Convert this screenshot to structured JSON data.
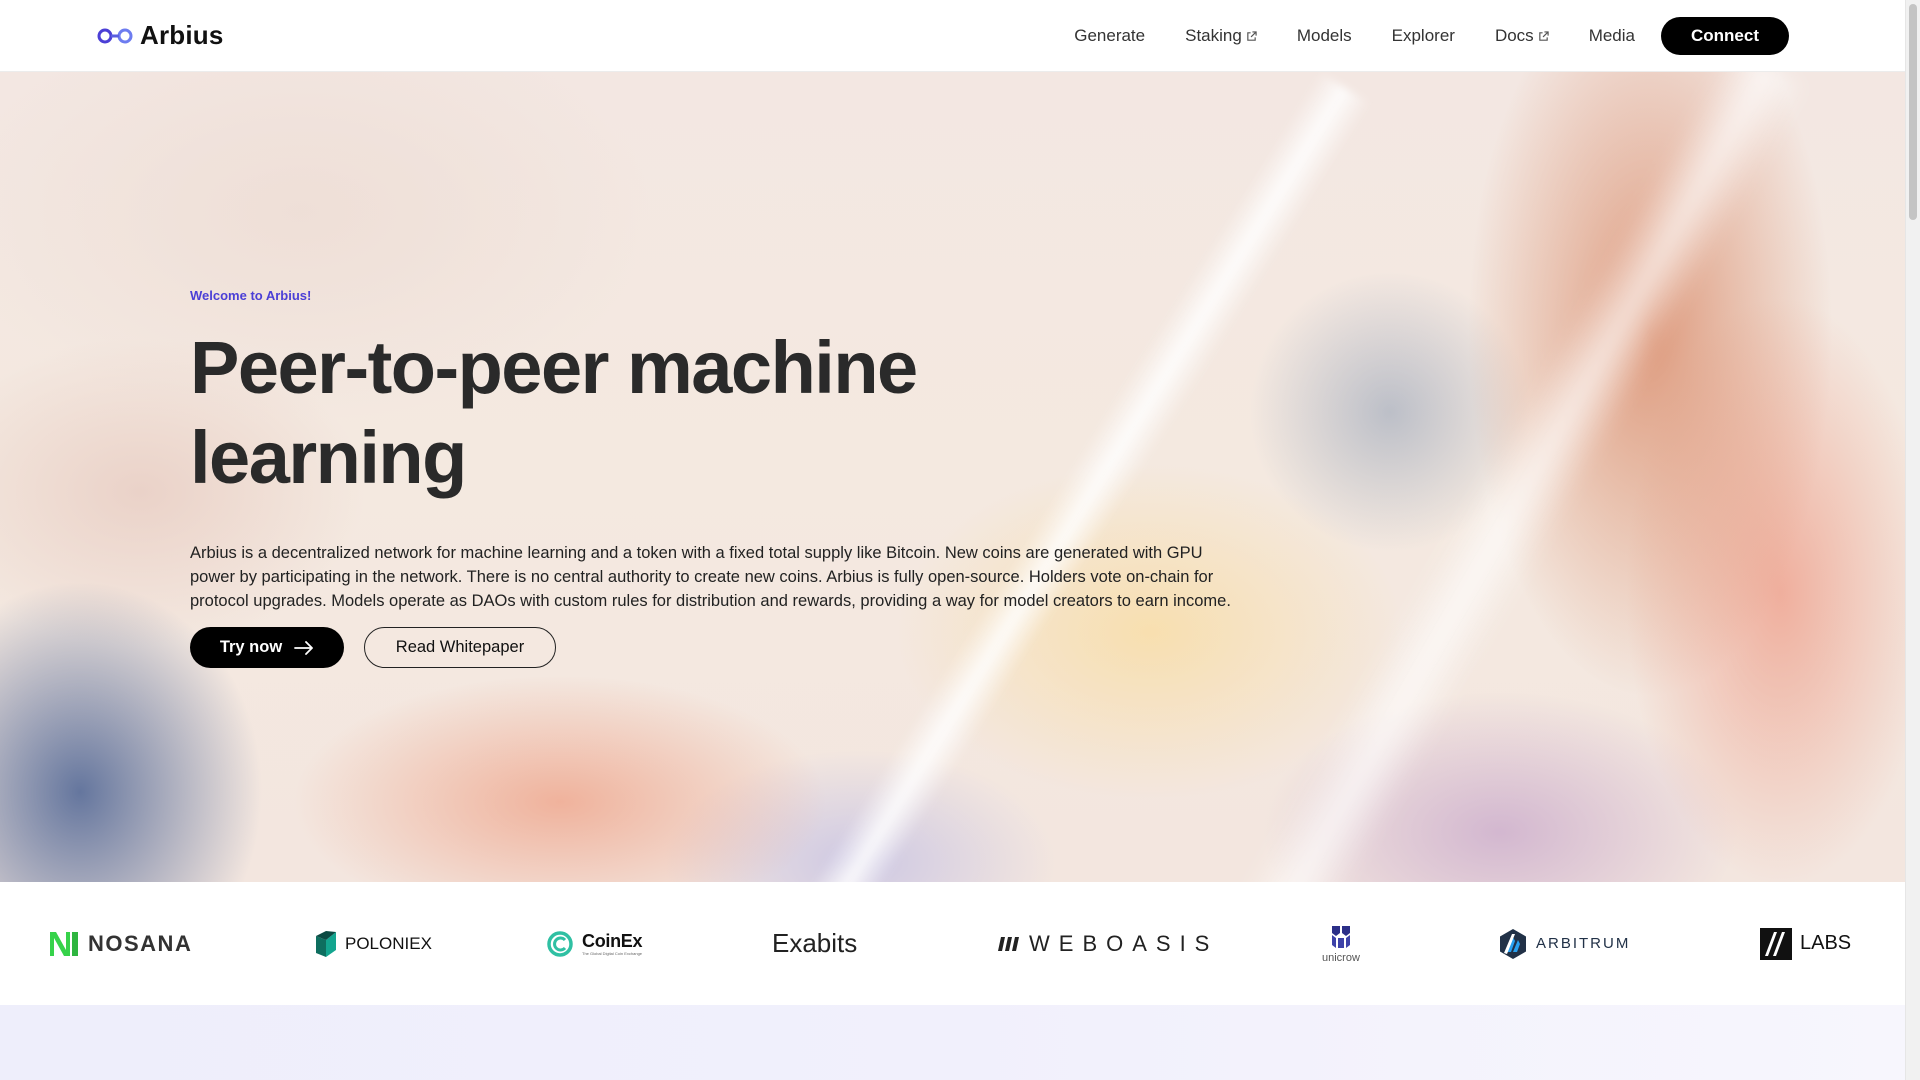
{
  "header": {
    "logo_text": "Arbius",
    "nav": [
      {
        "label": "Generate",
        "external": false
      },
      {
        "label": "Staking",
        "external": true
      },
      {
        "label": "Models",
        "external": false
      },
      {
        "label": "Explorer",
        "external": false
      },
      {
        "label": "Docs",
        "external": true
      },
      {
        "label": "Media",
        "external": false
      }
    ],
    "connect_label": "Connect"
  },
  "hero": {
    "eyebrow": "Welcome to Arbius!",
    "title": "Peer-to-peer machine learning",
    "description": "Arbius is a decentralized network for machine learning and a token with a fixed total supply like Bitcoin. New coins are generated with GPU power by participating in the network. There is no central authority to create new coins. Arbius is fully open-source. Holders vote on-chain for protocol upgrades. Models operate as DAOs with custom rules for distribution and rewards, providing a way for model creators to earn income.",
    "try_now_label": "Try now",
    "whitepaper_label": "Read Whitepaper"
  },
  "partners": {
    "nosana": "NOSANA",
    "poloniex": "POLONIEX",
    "coinex": "CoinEx",
    "coinex_tagline": "The Global Digital Coin Exchange",
    "exabits": "Exabits",
    "weboasis": "WEBOASIS",
    "unicrow": "unicrow",
    "arbitrum": "ARBITRUM",
    "labs": "LABS"
  },
  "colors": {
    "accent": "#4b3fd6",
    "primary_button": "#000000",
    "nosana_green": "#36d24a",
    "coinex_teal": "#2fc0a3",
    "unicrow_navy": "#2b2f88",
    "arbitrum_blue": "#213147"
  }
}
